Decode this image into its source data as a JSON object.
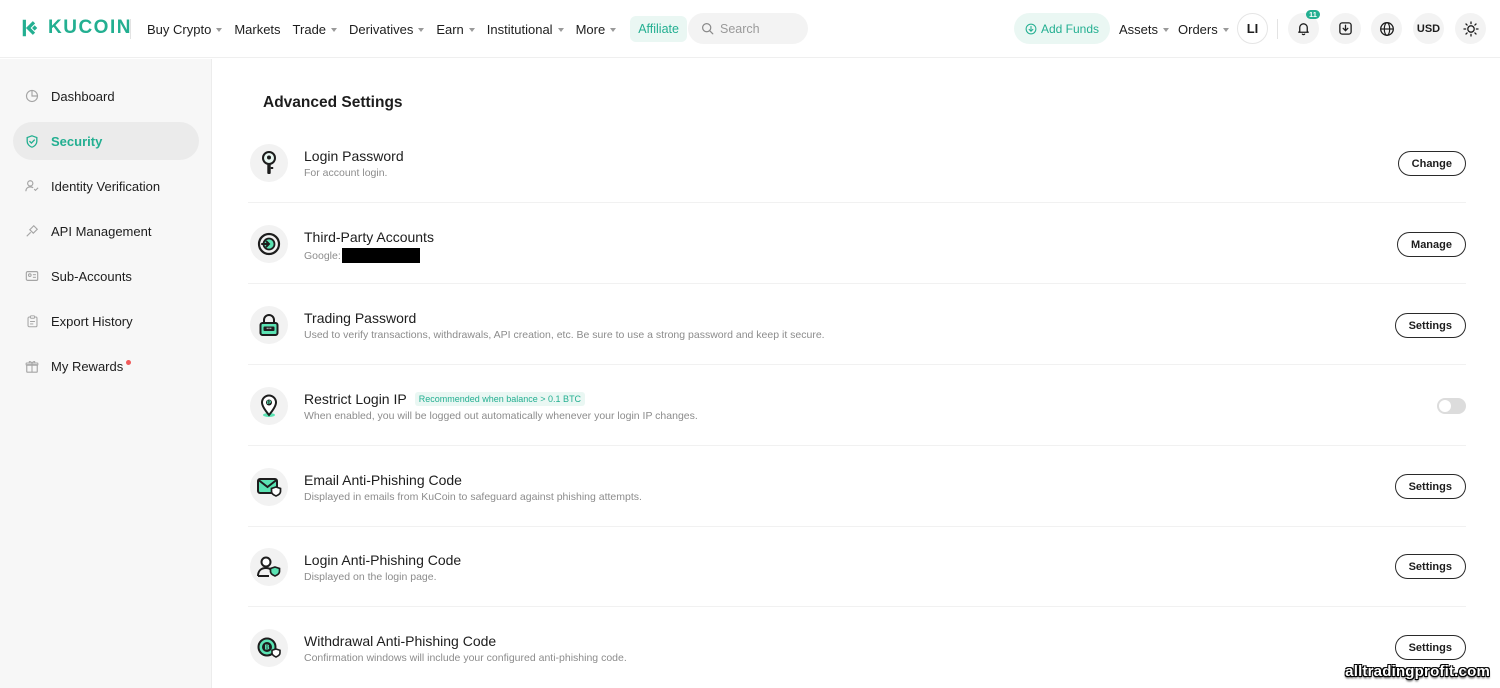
{
  "header": {
    "brand": "KUCOIN",
    "nav": [
      {
        "label": "Buy Crypto",
        "caret": true
      },
      {
        "label": "Markets",
        "caret": false
      },
      {
        "label": "Trade",
        "caret": true
      },
      {
        "label": "Derivatives",
        "caret": true
      },
      {
        "label": "Earn",
        "caret": true
      },
      {
        "label": "Institutional",
        "caret": true
      },
      {
        "label": "More",
        "caret": true
      }
    ],
    "affiliate": "Affiliate",
    "search_placeholder": "Search",
    "add_funds": "Add Funds",
    "assets": "Assets",
    "orders": "Orders",
    "avatar": "LI",
    "notification_count": "11",
    "currency": "USD"
  },
  "sidebar": {
    "items": [
      {
        "label": "Dashboard",
        "icon": "pie-chart-icon",
        "active": false
      },
      {
        "label": "Security",
        "icon": "shield-icon",
        "active": true
      },
      {
        "label": "Identity Verification",
        "icon": "user-check-icon",
        "active": false
      },
      {
        "label": "API Management",
        "icon": "api-plug-icon",
        "active": false
      },
      {
        "label": "Sub-Accounts",
        "icon": "sub-accounts-icon",
        "active": false
      },
      {
        "label": "Export History",
        "icon": "clipboard-icon",
        "active": false
      },
      {
        "label": "My Rewards",
        "icon": "gift-icon",
        "active": false,
        "dot": true
      }
    ]
  },
  "main": {
    "title": "Advanced Settings",
    "rows": [
      {
        "title": "Login Password",
        "desc": "For account login.",
        "action": "Change",
        "icon": "key-icon"
      },
      {
        "title": "Third-Party Accounts",
        "desc": "Google:",
        "redacted": true,
        "action": "Manage",
        "icon": "google-link-icon"
      },
      {
        "title": "Trading Password",
        "desc": "Used to verify transactions, withdrawals, API creation, etc. Be sure to use a strong password and keep it secure.",
        "action": "Settings",
        "icon": "lock-icon"
      },
      {
        "title": "Restrict Login IP",
        "tag": "Recommended when balance > 0.1 BTC",
        "desc": "When enabled, you will be logged out automatically whenever your login IP changes.",
        "action": "toggle",
        "toggle_on": false,
        "icon": "location-pin-icon"
      },
      {
        "title": "Email Anti-Phishing Code",
        "desc": "Displayed in emails from KuCoin to safeguard against phishing attempts.",
        "action": "Settings",
        "icon": "email-shield-icon"
      },
      {
        "title": "Login Anti-Phishing Code",
        "desc": "Displayed on the login page.",
        "action": "Settings",
        "icon": "user-shield-icon"
      },
      {
        "title": "Withdrawal Anti-Phishing Code",
        "desc": "Confirmation windows will include your configured anti-phishing code.",
        "action": "Settings",
        "icon": "coin-shield-icon"
      }
    ]
  },
  "watermark": "alltradingprofit.com",
  "colors": {
    "accent": "#23af91",
    "accent_bg": "#eaf7f3",
    "sidebar_bg": "#f7f7f7"
  }
}
